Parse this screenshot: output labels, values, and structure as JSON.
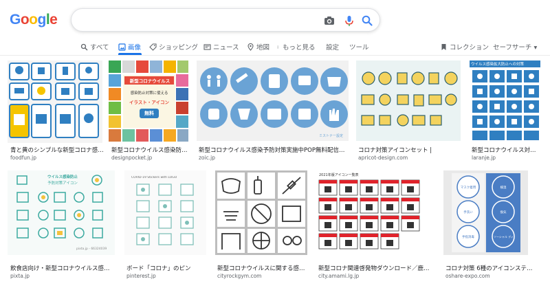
{
  "logo": {
    "letters": [
      "G",
      "o",
      "o",
      "g",
      "l",
      "e"
    ]
  },
  "search": {
    "value": "",
    "camera_icon": "camera-icon",
    "mic_icon": "mic-icon",
    "search_icon": "search-icon"
  },
  "tabs": [
    {
      "label": "すべて",
      "icon": "search-icon"
    },
    {
      "label": "画像",
      "icon": "image-icon"
    },
    {
      "label": "ショッピング",
      "icon": "tag-icon"
    },
    {
      "label": "ニュース",
      "icon": "news-icon"
    },
    {
      "label": "地図",
      "icon": "map-pin-icon"
    },
    {
      "label": "もっと見る",
      "icon": "more-icon"
    },
    {
      "label": "設定"
    },
    {
      "label": "ツール"
    }
  ],
  "right_tabs": {
    "collections": "コレクション",
    "safesearch": "セーフサーチ ▾"
  },
  "results": [
    {
      "caption": "青と黄のシンプルな新型コロナ感…",
      "source": "foodfun.jp"
    },
    {
      "caption": "新型コロナウイルス感染防止…",
      "source": "designpocket.jp"
    },
    {
      "caption": "新型コロナウイルス感染予防対策実施中POP無料配信中 | Z…",
      "source": "zoic.jp"
    },
    {
      "caption": "コロナ対策アイコンセット |",
      "source": "apricot-design.com"
    },
    {
      "caption": "新型コロナウイルス対…",
      "source": "laranje.jp"
    },
    {
      "caption": "飲食店向け・新型コロナウイルス感染症…",
      "source": "pixta.jp"
    },
    {
      "caption": "ボード「コロナ」のピン",
      "source": "pinterest.jp"
    },
    {
      "caption": "新型コロナウイルスに関する感染…",
      "source": "cityrockgym.com"
    },
    {
      "caption": "新型コロナ関連啓発物ダウンロード／鹿児島…",
      "source": "city.amami.lg.jp"
    },
    {
      "caption": "コロナ対策 6種のアイコンステッ…",
      "source": "oshare-expo.com"
    }
  ],
  "image_text": {
    "designpocket_title": "新型コロナウイルス",
    "designpocket_sub": "感染防止対策に使える",
    "designpocket_sub2": "イラスト・アイコン",
    "designpocket_badge": "無料",
    "zoic_footer": "ミストナー設定",
    "laranje_title": "ウイルス感染拡大防止への対策",
    "pixta_title": "ウイルス感染防止",
    "pixta_sub": "予防対策アイコン",
    "pixta_watermark": "pixta.jp - 66324039",
    "pinterest_header": "COVID-19 Stickers with LOGO",
    "amami_title": "2021年版アイコン一覧表",
    "oshare_1": "マスク着用",
    "oshare_2": "手洗い",
    "oshare_3": "手指消毒",
    "oshare_4": "検温",
    "oshare_5": "換気",
    "oshare_6": "ソーシャル ディスタンス"
  },
  "colors": {
    "blue": "#1a73e8",
    "google_blue": "#4285f4",
    "google_red": "#ea4335",
    "google_yellow": "#fbbc05",
    "google_green": "#34a853",
    "icon_blue": "#6aa3d5"
  }
}
